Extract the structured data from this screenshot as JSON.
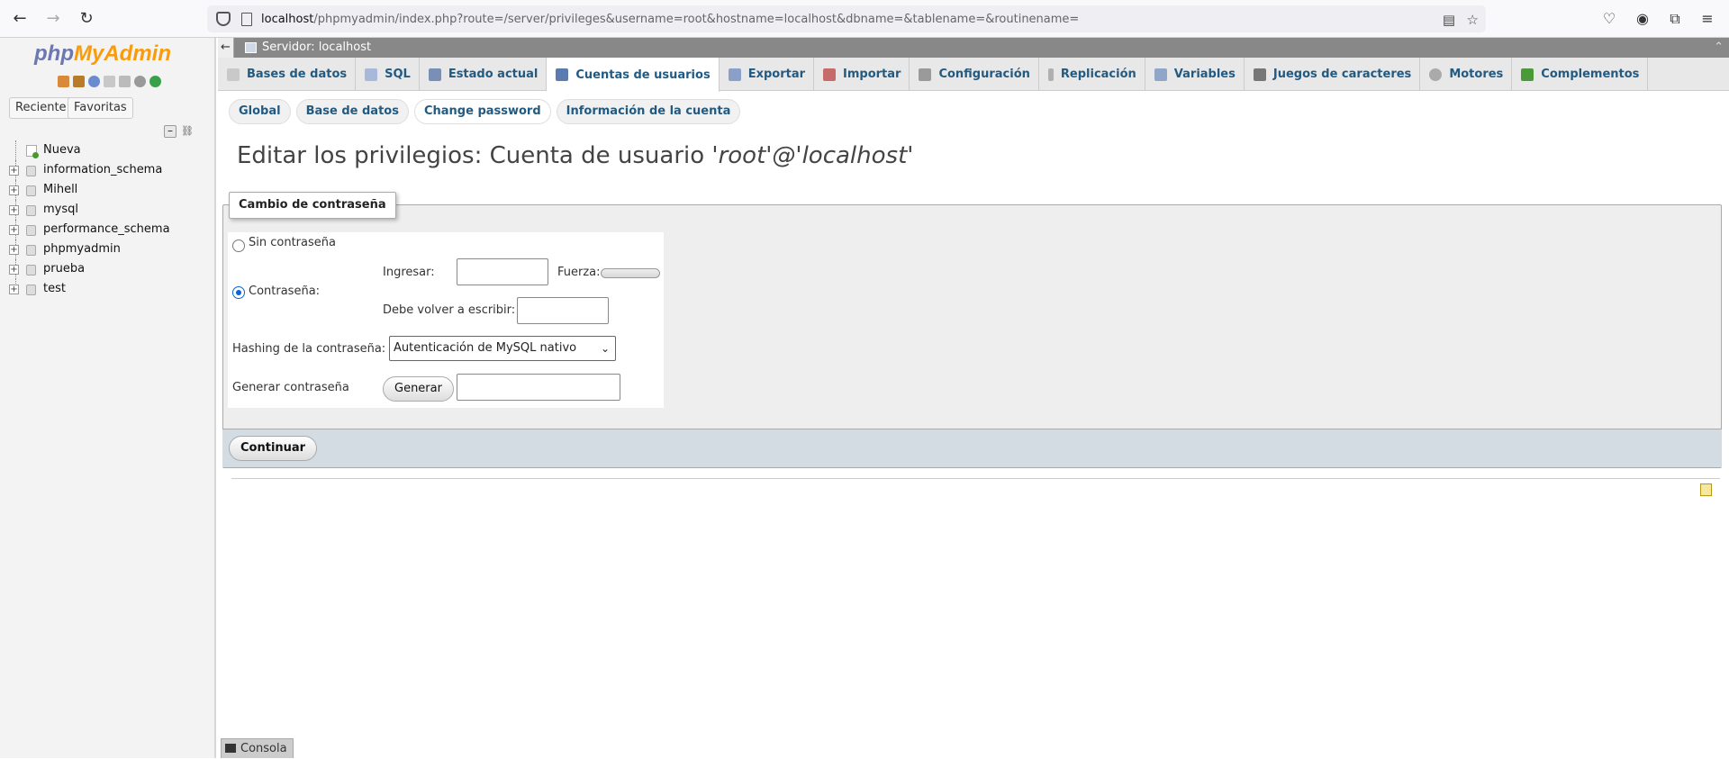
{
  "browser": {
    "url_host": "localhost",
    "url_path": "/phpmyadmin/index.php?route=/server/privileges&username=root&hostname=localhost&dbname=&tablename=&routinename="
  },
  "sidebar": {
    "logo": {
      "php": "php",
      "my": "MyAdmin"
    },
    "tabs": {
      "recent": "Reciente",
      "favorites": "Favoritas"
    },
    "tree": [
      {
        "label": "Nueva",
        "type": "new"
      },
      {
        "label": "information_schema",
        "type": "db"
      },
      {
        "label": "Mihell",
        "type": "db"
      },
      {
        "label": "mysql",
        "type": "db"
      },
      {
        "label": "performance_schema",
        "type": "db"
      },
      {
        "label": "phpmyadmin",
        "type": "db"
      },
      {
        "label": "prueba",
        "type": "db"
      },
      {
        "label": "test",
        "type": "db"
      }
    ]
  },
  "server_bar": {
    "label": "Servidor: localhost"
  },
  "main_tabs": [
    {
      "label": "Bases de datos",
      "icon": "database-icon"
    },
    {
      "label": "SQL",
      "icon": "sql-icon"
    },
    {
      "label": "Estado actual",
      "icon": "status-icon"
    },
    {
      "label": "Cuentas de usuarios",
      "icon": "users-icon",
      "active": true
    },
    {
      "label": "Exportar",
      "icon": "export-icon"
    },
    {
      "label": "Importar",
      "icon": "import-icon"
    },
    {
      "label": "Configuración",
      "icon": "wrench-icon"
    },
    {
      "label": "Replicación",
      "icon": "replication-icon"
    },
    {
      "label": "Variables",
      "icon": "variables-icon"
    },
    {
      "label": "Juegos de caracteres",
      "icon": "charset-icon"
    },
    {
      "label": "Motores",
      "icon": "engines-icon"
    },
    {
      "label": "Complementos",
      "icon": "plugins-icon"
    }
  ],
  "sub_tabs": [
    {
      "label": "Global"
    },
    {
      "label": "Base de datos"
    },
    {
      "label": "Change password",
      "active": true
    },
    {
      "label": "Información de la cuenta"
    }
  ],
  "page": {
    "title_prefix": "Editar los privilegios: Cuenta de usuario ",
    "title_user": "'root'@'localhost'"
  },
  "form": {
    "legend": "Cambio de contraseña",
    "no_password_label": "Sin contraseña",
    "password_label": "Contraseña:",
    "enter_label": "Ingresar:",
    "enter_value": "",
    "strength_label": "Fuerza:",
    "retype_label": "Debe volver a escribir:",
    "retype_value": "",
    "hashing_label": "Hashing de la contraseña:",
    "hashing_value": "Autenticación de MySQL nativo",
    "generate_label": "Generar contraseña",
    "generate_button": "Generar",
    "generated_value": "",
    "continue_button": "Continuar"
  },
  "console": {
    "label": "Consola"
  },
  "colors": {
    "link": "#235a81",
    "accent": "#f89c0e",
    "radio_checked": "#0a64d6"
  }
}
